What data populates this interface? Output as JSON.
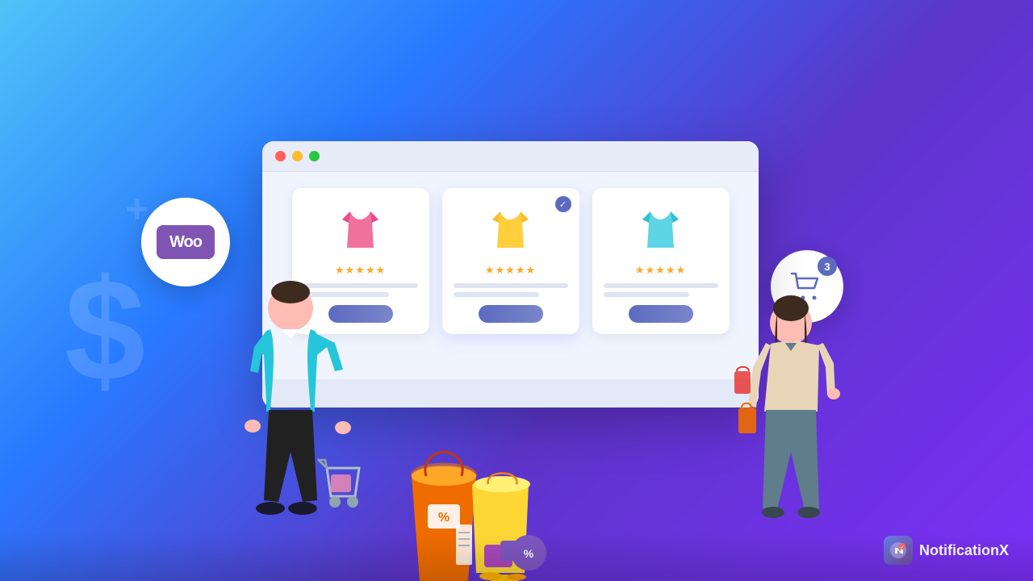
{
  "background": {
    "gradient_start": "#4fc3f7",
    "gradient_end": "#7b2ff7"
  },
  "woo_badge": {
    "text": "Woo",
    "bg_color": "#7f54b3"
  },
  "cart_badge": {
    "count": "3"
  },
  "browser": {
    "dots": [
      "#ff5f57",
      "#febc2e",
      "#28c840"
    ],
    "products": [
      {
        "id": "product-1",
        "shirt_color": "#f06292",
        "stars": "★★★★★",
        "featured": false
      },
      {
        "id": "product-2",
        "shirt_color": "#ffca28",
        "stars": "★★★★★",
        "featured": true
      },
      {
        "id": "product-3",
        "shirt_color": "#4dd0e1",
        "stars": "★★★★★",
        "featured": false
      }
    ]
  },
  "notificationx": {
    "brand_name": "NotificationX",
    "icon_text": "N"
  }
}
